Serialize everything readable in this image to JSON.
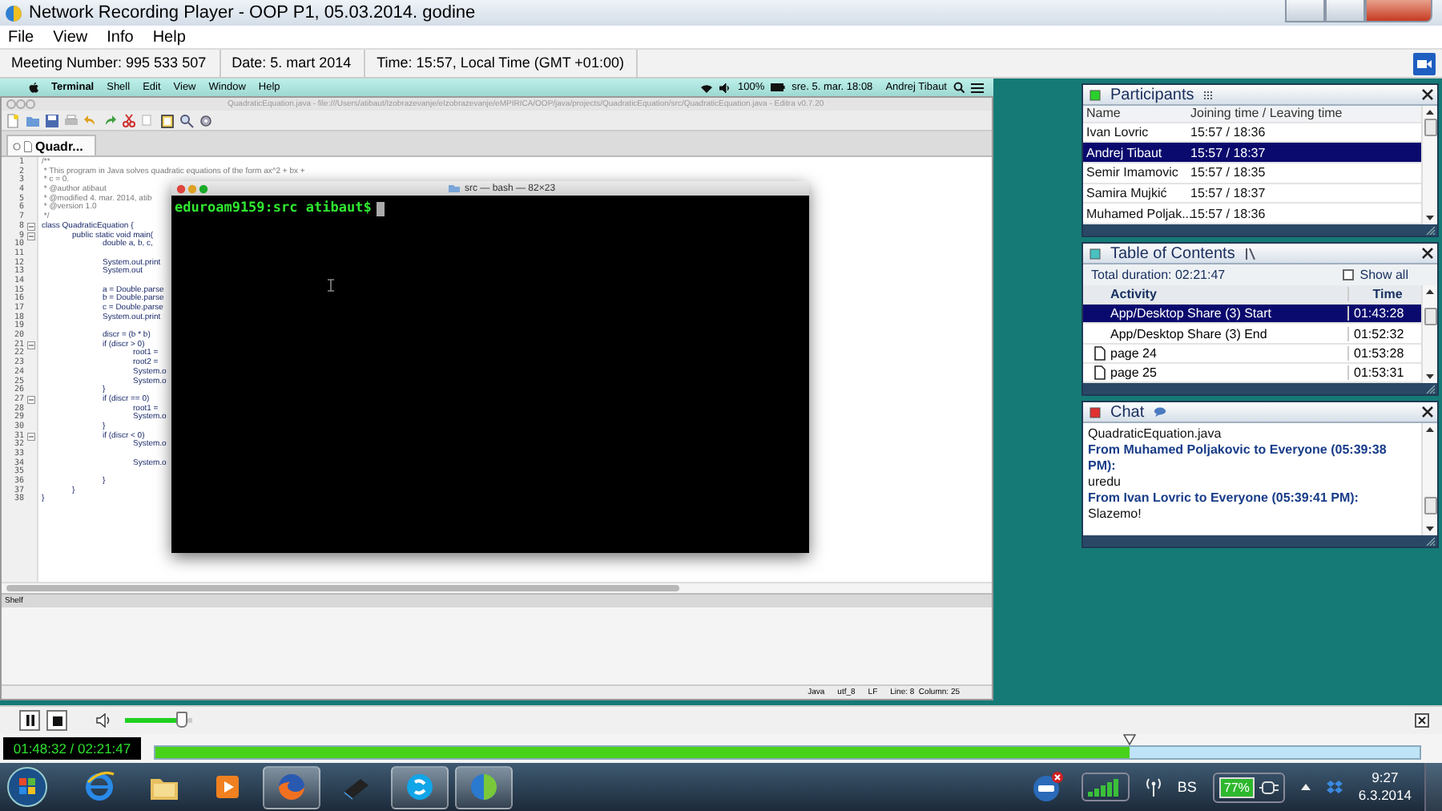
{
  "window": {
    "title": "Network Recording Player - OOP P1, 05.03.2014. godine"
  },
  "menu": [
    "File",
    "View",
    "Info",
    "Help"
  ],
  "info_bar": [
    "Meeting Number: 995 533 507",
    "Date: 5. mart 2014",
    "Time: 15:57, Local Time (GMT +01:00)"
  ],
  "shared_screen": {
    "mac_menu": [
      {
        "label": "Terminal",
        "kind": "app"
      },
      {
        "label": "Shell",
        "kind": "item"
      },
      {
        "label": "Edit",
        "kind": "item"
      },
      {
        "label": "View",
        "kind": "item"
      },
      {
        "label": "Window",
        "kind": "item"
      },
      {
        "label": "Help",
        "kind": "item"
      }
    ],
    "mac_status": {
      "battery": "100%",
      "clock": "sre. 5. mar.  18:08",
      "user": "Andrej Tibaut"
    },
    "editor": {
      "title": "QuadraticEquation.java - file:///Users/atibaut/Izobrazevanje/eIzobrazevanje/eMPIRICA/OOP/java/projects/QuadraticEquation/src/QuadraticEquation.java - Editra v0.7.20",
      "tab": "Quadr...",
      "lines": [
        {
          "number": "1",
          "text": "/**",
          "kind": "comment",
          "fold": false
        },
        {
          "number": "2",
          "text": " * This program in Java solves quadratic equations of the form ax^2 + bx +",
          "kind": "comment",
          "fold": false
        },
        {
          "number": "3",
          "text": " * c = 0.",
          "kind": "comment",
          "fold": false
        },
        {
          "number": "4",
          "text": " * @author atibaut",
          "kind": "comment",
          "fold": false
        },
        {
          "number": "5",
          "text": " * @modified 4. mar. 2014, atib",
          "kind": "comment",
          "fold": false
        },
        {
          "number": "6",
          "text": " * @version 1.0",
          "kind": "comment",
          "fold": false
        },
        {
          "number": "7",
          "text": " */",
          "kind": "comment",
          "fold": false
        },
        {
          "number": "8",
          "text": "class QuadraticEquation {",
          "kind": "code",
          "fold": true
        },
        {
          "number": "9",
          "text": "\tpublic static void main(",
          "kind": "code",
          "fold": true
        },
        {
          "number": "10",
          "text": "\t\tdouble a, b, c,",
          "kind": "code",
          "fold": false
        },
        {
          "number": "11",
          "kind": "code",
          "fold": false
        },
        {
          "number": "12",
          "text": "\t\tSystem.out.print",
          "kind": "code",
          "fold": false
        },
        {
          "number": "13",
          "text": "\t\tSystem.out",
          "kind": "code",
          "fold": false
        },
        {
          "number": "14",
          "kind": "code",
          "fold": false
        },
        {
          "number": "15",
          "text": "\t\ta = Double.parse",
          "kind": "code",
          "fold": false
        },
        {
          "number": "16",
          "text": "\t\tb = Double.parse",
          "kind": "code",
          "fold": false
        },
        {
          "number": "17",
          "text": "\t\tc = Double.parse",
          "kind": "code",
          "fold": false
        },
        {
          "number": "18",
          "text": "\t\tSystem.out.print",
          "kind": "code",
          "fold": false
        },
        {
          "number": "19",
          "kind": "code",
          "fold": false
        },
        {
          "number": "20",
          "text": "\t\tdiscr = (b * b)",
          "kind": "code",
          "fold": false
        },
        {
          "number": "21",
          "text": "\t\tif (discr > 0)",
          "kind": "code",
          "fold": true
        },
        {
          "number": "22",
          "text": "\t\t\troot1 =",
          "kind": "code",
          "fold": false
        },
        {
          "number": "23",
          "text": "\t\t\troot2 =",
          "kind": "code",
          "fold": false
        },
        {
          "number": "24",
          "text": "\t\t\tSystem.o",
          "kind": "code",
          "fold": false
        },
        {
          "number": "25",
          "text": "\t\t\tSystem.o",
          "kind": "code",
          "fold": false
        },
        {
          "number": "26",
          "text": "\t\t}",
          "kind": "code",
          "fold": false
        },
        {
          "number": "27",
          "text": "\t\tif (discr == 0)",
          "kind": "code",
          "fold": true
        },
        {
          "number": "28",
          "text": "\t\t\troot1 =",
          "kind": "code",
          "fold": false
        },
        {
          "number": "29",
          "text": "\t\t\tSystem.o",
          "kind": "code",
          "fold": false
        },
        {
          "number": "30",
          "text": "\t\t}",
          "kind": "code",
          "fold": false
        },
        {
          "number": "31",
          "text": "\t\tif (discr < 0)",
          "kind": "code",
          "fold": true
        },
        {
          "number": "32",
          "text": "\t\t\tSystem.o",
          "kind": "code",
          "fold": false
        },
        {
          "number": "33",
          "kind": "code",
          "fold": false
        },
        {
          "number": "34",
          "text": "\t\t\tSystem.o",
          "kind": "code",
          "fold": false
        },
        {
          "number": "35",
          "kind": "code",
          "fold": false
        },
        {
          "number": "36",
          "text": "\t\t}",
          "kind": "code",
          "fold": false
        },
        {
          "number": "37",
          "text": "\t}",
          "kind": "code",
          "fold": false
        },
        {
          "number": "38",
          "text": "}",
          "kind": "code",
          "fold": false
        }
      ],
      "shelf": "Shelf",
      "status": [
        "Java",
        "utf_8",
        "LF",
        "Line: 8  Column: 25"
      ]
    },
    "terminal": {
      "title": "src — bash — 82×23",
      "prompt": "eduroam9159:src atibaut$"
    }
  },
  "participants": {
    "title": "Participants",
    "columns": [
      "Name",
      "Joining time / Leaving time"
    ],
    "rows": [
      {
        "name": "Ivan Lovric",
        "time": "15:57 / 18:36",
        "selected": false
      },
      {
        "name": "Andrej Tibaut",
        "time": "15:57 / 18:37",
        "selected": true
      },
      {
        "name": "Semir Imamovic",
        "time": "15:57 / 18:35",
        "selected": false
      },
      {
        "name": "Samira Mujkić",
        "time": "15:57 / 18:37",
        "selected": false
      },
      {
        "name": "Muhamed Poljak...",
        "time": "15:57 / 18:36",
        "selected": false
      }
    ]
  },
  "toc": {
    "title": "Table of Contents",
    "total": "Total duration: 02:21:47",
    "show_all": {
      "label": "Show all",
      "checked": false
    },
    "columns": [
      "Activity",
      "Time"
    ],
    "rows": [
      {
        "kind": "event",
        "activity": "App/Desktop Share (3) Start",
        "time": "01:43:28",
        "selected": true
      },
      {
        "kind": "event",
        "activity": "App/Desktop Share (3) End",
        "time": "01:52:32",
        "selected": false
      },
      {
        "kind": "page",
        "activity": "page 24",
        "time": "01:53:28",
        "selected": false
      },
      {
        "kind": "page",
        "activity": "page 25",
        "time": "01:53:31",
        "selected": false
      }
    ]
  },
  "chat": {
    "title": "Chat",
    "messages": [
      {
        "kind": "text",
        "text": "QuadraticEquation.java"
      },
      {
        "kind": "sender",
        "text": "From Muhamed Poljakovic to Everyone (05:39:38 PM):"
      },
      {
        "kind": "text",
        "text": "uredu"
      },
      {
        "kind": "sender",
        "text": "From Ivan Lovric to Everyone (05:39:41 PM):"
      },
      {
        "kind": "text",
        "text": "Slazemo!"
      }
    ]
  },
  "player": {
    "volume": {
      "level": 0.85
    },
    "time": "01:48:32 / 02:21:47",
    "progress": {
      "level": 0.77
    }
  },
  "taskbar": {
    "language": "BS",
    "battery": "77%",
    "time": "9:27",
    "date": "6.3.2014"
  }
}
